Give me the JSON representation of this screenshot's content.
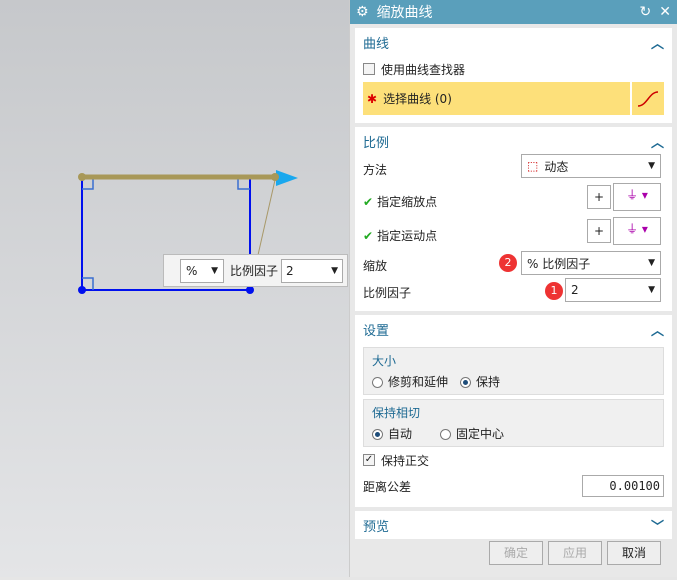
{
  "dialog": {
    "title": "缩放曲线"
  },
  "curve": {
    "header": "曲线",
    "use_finder": "使用曲线查找器",
    "select": "选择曲线 (0)"
  },
  "scale": {
    "header": "比例",
    "method_label": "方法",
    "method_value": "动态",
    "scale_point": "指定缩放点",
    "move_point": "指定运动点",
    "scale_label": "缩放",
    "scale_value": "% 比例因子",
    "factor_label": "比例因子",
    "factor_value": "2",
    "badge1": "1",
    "badge2": "2"
  },
  "settings": {
    "header": "设置",
    "size": "大小",
    "trim": "修剪和延伸",
    "keep": "保持",
    "tangent": "保持相切",
    "auto": "自动",
    "fixed_center": "固定中心",
    "keep_ortho": "保持正交",
    "dist_tol_label": "距离公差",
    "dist_tol": "0.00100"
  },
  "preview": {
    "header": "预览"
  },
  "buttons": {
    "ok": "确定",
    "apply": "应用",
    "cancel": "取消"
  },
  "overlay": {
    "unit": "%",
    "label": "比例因子",
    "value": "2"
  }
}
